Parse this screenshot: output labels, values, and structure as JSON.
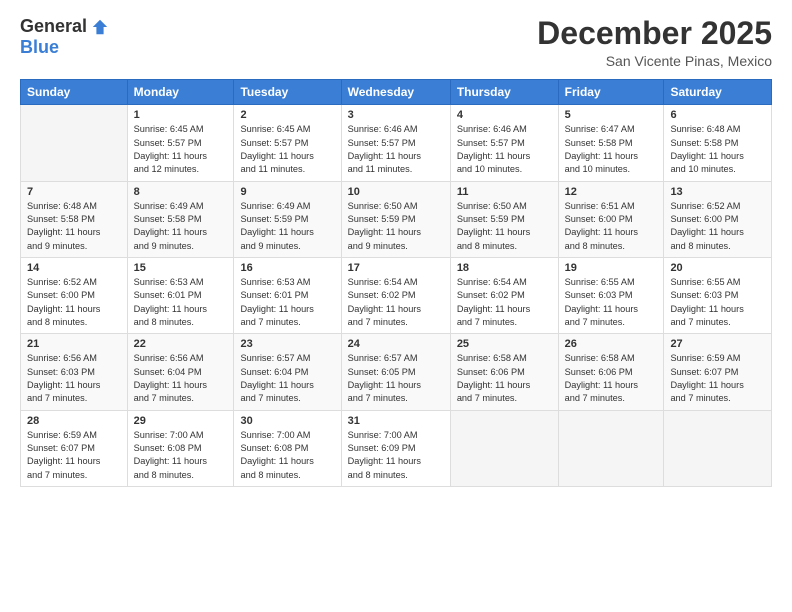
{
  "header": {
    "logo_general": "General",
    "logo_blue": "Blue",
    "month_title": "December 2025",
    "subtitle": "San Vicente Pinas, Mexico"
  },
  "days_of_week": [
    "Sunday",
    "Monday",
    "Tuesday",
    "Wednesday",
    "Thursday",
    "Friday",
    "Saturday"
  ],
  "weeks": [
    [
      {
        "day": "",
        "info": ""
      },
      {
        "day": "1",
        "info": "Sunrise: 6:45 AM\nSunset: 5:57 PM\nDaylight: 11 hours\nand 12 minutes."
      },
      {
        "day": "2",
        "info": "Sunrise: 6:45 AM\nSunset: 5:57 PM\nDaylight: 11 hours\nand 11 minutes."
      },
      {
        "day": "3",
        "info": "Sunrise: 6:46 AM\nSunset: 5:57 PM\nDaylight: 11 hours\nand 11 minutes."
      },
      {
        "day": "4",
        "info": "Sunrise: 6:46 AM\nSunset: 5:57 PM\nDaylight: 11 hours\nand 10 minutes."
      },
      {
        "day": "5",
        "info": "Sunrise: 6:47 AM\nSunset: 5:58 PM\nDaylight: 11 hours\nand 10 minutes."
      },
      {
        "day": "6",
        "info": "Sunrise: 6:48 AM\nSunset: 5:58 PM\nDaylight: 11 hours\nand 10 minutes."
      }
    ],
    [
      {
        "day": "7",
        "info": "Sunrise: 6:48 AM\nSunset: 5:58 PM\nDaylight: 11 hours\nand 9 minutes."
      },
      {
        "day": "8",
        "info": "Sunrise: 6:49 AM\nSunset: 5:58 PM\nDaylight: 11 hours\nand 9 minutes."
      },
      {
        "day": "9",
        "info": "Sunrise: 6:49 AM\nSunset: 5:59 PM\nDaylight: 11 hours\nand 9 minutes."
      },
      {
        "day": "10",
        "info": "Sunrise: 6:50 AM\nSunset: 5:59 PM\nDaylight: 11 hours\nand 9 minutes."
      },
      {
        "day": "11",
        "info": "Sunrise: 6:50 AM\nSunset: 5:59 PM\nDaylight: 11 hours\nand 8 minutes."
      },
      {
        "day": "12",
        "info": "Sunrise: 6:51 AM\nSunset: 6:00 PM\nDaylight: 11 hours\nand 8 minutes."
      },
      {
        "day": "13",
        "info": "Sunrise: 6:52 AM\nSunset: 6:00 PM\nDaylight: 11 hours\nand 8 minutes."
      }
    ],
    [
      {
        "day": "14",
        "info": "Sunrise: 6:52 AM\nSunset: 6:00 PM\nDaylight: 11 hours\nand 8 minutes."
      },
      {
        "day": "15",
        "info": "Sunrise: 6:53 AM\nSunset: 6:01 PM\nDaylight: 11 hours\nand 8 minutes."
      },
      {
        "day": "16",
        "info": "Sunrise: 6:53 AM\nSunset: 6:01 PM\nDaylight: 11 hours\nand 7 minutes."
      },
      {
        "day": "17",
        "info": "Sunrise: 6:54 AM\nSunset: 6:02 PM\nDaylight: 11 hours\nand 7 minutes."
      },
      {
        "day": "18",
        "info": "Sunrise: 6:54 AM\nSunset: 6:02 PM\nDaylight: 11 hours\nand 7 minutes."
      },
      {
        "day": "19",
        "info": "Sunrise: 6:55 AM\nSunset: 6:03 PM\nDaylight: 11 hours\nand 7 minutes."
      },
      {
        "day": "20",
        "info": "Sunrise: 6:55 AM\nSunset: 6:03 PM\nDaylight: 11 hours\nand 7 minutes."
      }
    ],
    [
      {
        "day": "21",
        "info": "Sunrise: 6:56 AM\nSunset: 6:03 PM\nDaylight: 11 hours\nand 7 minutes."
      },
      {
        "day": "22",
        "info": "Sunrise: 6:56 AM\nSunset: 6:04 PM\nDaylight: 11 hours\nand 7 minutes."
      },
      {
        "day": "23",
        "info": "Sunrise: 6:57 AM\nSunset: 6:04 PM\nDaylight: 11 hours\nand 7 minutes."
      },
      {
        "day": "24",
        "info": "Sunrise: 6:57 AM\nSunset: 6:05 PM\nDaylight: 11 hours\nand 7 minutes."
      },
      {
        "day": "25",
        "info": "Sunrise: 6:58 AM\nSunset: 6:06 PM\nDaylight: 11 hours\nand 7 minutes."
      },
      {
        "day": "26",
        "info": "Sunrise: 6:58 AM\nSunset: 6:06 PM\nDaylight: 11 hours\nand 7 minutes."
      },
      {
        "day": "27",
        "info": "Sunrise: 6:59 AM\nSunset: 6:07 PM\nDaylight: 11 hours\nand 7 minutes."
      }
    ],
    [
      {
        "day": "28",
        "info": "Sunrise: 6:59 AM\nSunset: 6:07 PM\nDaylight: 11 hours\nand 7 minutes."
      },
      {
        "day": "29",
        "info": "Sunrise: 7:00 AM\nSunset: 6:08 PM\nDaylight: 11 hours\nand 8 minutes."
      },
      {
        "day": "30",
        "info": "Sunrise: 7:00 AM\nSunset: 6:08 PM\nDaylight: 11 hours\nand 8 minutes."
      },
      {
        "day": "31",
        "info": "Sunrise: 7:00 AM\nSunset: 6:09 PM\nDaylight: 11 hours\nand 8 minutes."
      },
      {
        "day": "",
        "info": ""
      },
      {
        "day": "",
        "info": ""
      },
      {
        "day": "",
        "info": ""
      }
    ]
  ]
}
